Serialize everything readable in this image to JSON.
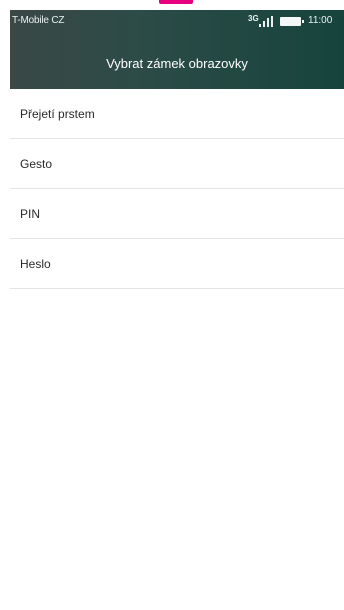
{
  "status_bar": {
    "carrier": "T-Mobile CZ",
    "network_type": "3G",
    "time": "11:00",
    "icons": [
      "signal-icon",
      "battery-icon"
    ]
  },
  "header": {
    "title": "Vybrat zámek obrazovky"
  },
  "options": [
    {
      "label": "Přejetí prstem"
    },
    {
      "label": "Gesto"
    },
    {
      "label": "PIN"
    },
    {
      "label": "Heslo"
    }
  ],
  "colors": {
    "header_start": "#3a4846",
    "header_end": "#16443c",
    "accent_marker": "#e6007e",
    "divider": "#e4e4e4"
  }
}
